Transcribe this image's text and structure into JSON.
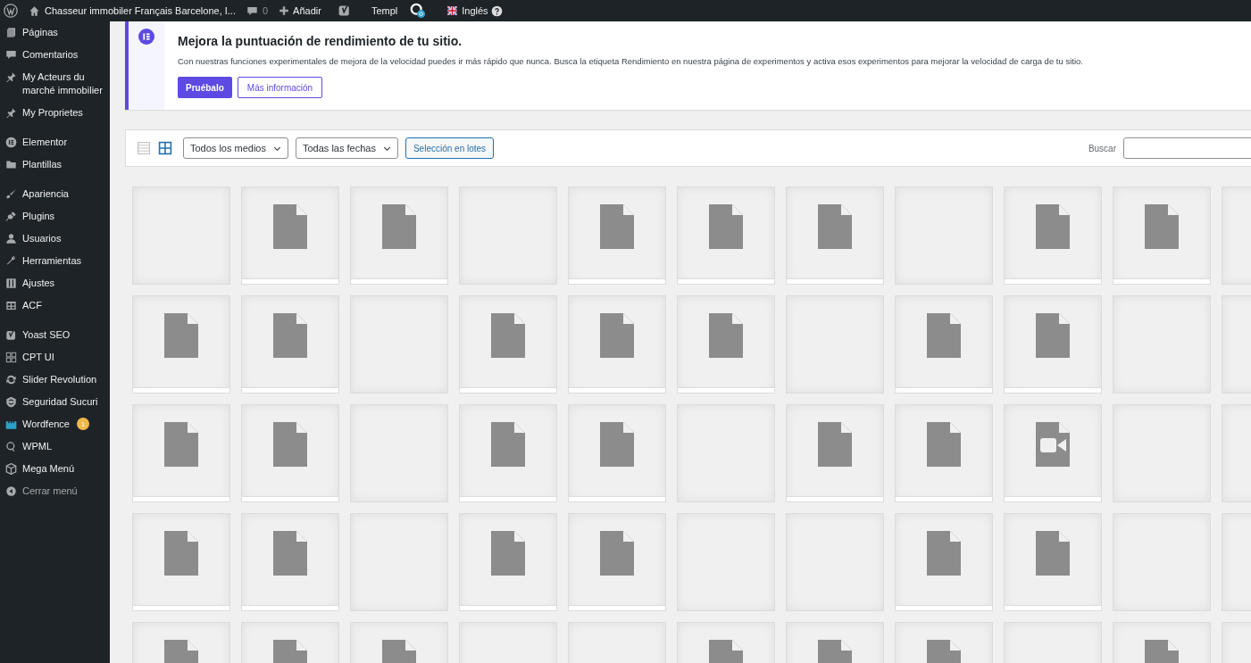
{
  "admin_bar": {
    "site_name": "Chasseur immobiler Français Barcelone, I...",
    "comments_count": "0",
    "new_label": "Añadir",
    "templ_label": "Templ",
    "language": "Inglés"
  },
  "sidebar": {
    "groups": [
      [
        {
          "label": "Páginas"
        },
        {
          "label": "Comentarios"
        },
        {
          "label": "My Acteurs du marché immobilier"
        },
        {
          "label": "My Proprietes"
        }
      ],
      [
        {
          "label": "Elementor"
        },
        {
          "label": "Plantillas"
        }
      ],
      [
        {
          "label": "Apariencia"
        },
        {
          "label": "Plugins"
        },
        {
          "label": "Usuarios"
        },
        {
          "label": "Herramientas"
        },
        {
          "label": "Ajustes"
        },
        {
          "label": "ACF"
        }
      ],
      [
        {
          "label": "Yoast SEO"
        },
        {
          "label": "CPT UI"
        },
        {
          "label": "Slider Revolution"
        },
        {
          "label": "Seguridad Sucuri"
        },
        {
          "label": "Wordfence",
          "badge": "1"
        },
        {
          "label": "WPML"
        },
        {
          "label": "Mega Menú"
        },
        {
          "label": "Cerrar menú"
        }
      ]
    ]
  },
  "notice": {
    "title": "Mejora la puntuación de rendimiento de tu sitio.",
    "body": "Con nuestras funciones experimentales de mejora de la velocidad puedes ir más rápido que nunca. Busca la etiqueta Rendimiento en nuestra página de experimentos y activa esos experimentos para mejorar la velocidad de carga de tu sitio.",
    "primary_button": "Pruébalo",
    "secondary_button": "Más información"
  },
  "toolbar": {
    "views": [
      {
        "kind": "list",
        "selected": false
      },
      {
        "kind": "grid",
        "selected": true
      }
    ],
    "type_filter": "Todos los medios",
    "date_filter": "Todas las fechas",
    "bulk_button": "Selección en lotes",
    "search_label": "Buscar"
  },
  "media_tiles": [
    {
      "kind": "empty"
    },
    {
      "kind": "document"
    },
    {
      "kind": "document"
    },
    {
      "kind": "empty"
    },
    {
      "kind": "document"
    },
    {
      "kind": "document"
    },
    {
      "kind": "document"
    },
    {
      "kind": "empty"
    },
    {
      "kind": "document"
    },
    {
      "kind": "document"
    },
    {
      "kind": "empty"
    },
    {
      "kind": "document"
    },
    {
      "kind": "document"
    },
    {
      "kind": "empty"
    },
    {
      "kind": "document"
    },
    {
      "kind": "document"
    },
    {
      "kind": "document"
    },
    {
      "kind": "empty"
    },
    {
      "kind": "document"
    },
    {
      "kind": "document"
    },
    {
      "kind": "empty"
    },
    {
      "kind": "empty"
    },
    {
      "kind": "document"
    },
    {
      "kind": "document"
    },
    {
      "kind": "empty"
    },
    {
      "kind": "document"
    },
    {
      "kind": "document"
    },
    {
      "kind": "empty"
    },
    {
      "kind": "document"
    },
    {
      "kind": "document"
    },
    {
      "kind": "video"
    },
    {
      "kind": "empty"
    },
    {
      "kind": "empty"
    },
    {
      "kind": "document"
    },
    {
      "kind": "document"
    },
    {
      "kind": "empty"
    },
    {
      "kind": "document"
    },
    {
      "kind": "document"
    },
    {
      "kind": "empty"
    },
    {
      "kind": "empty"
    },
    {
      "kind": "document"
    },
    {
      "kind": "document"
    },
    {
      "kind": "empty"
    },
    {
      "kind": "empty"
    },
    {
      "kind": "document"
    },
    {
      "kind": "document"
    },
    {
      "kind": "document"
    },
    {
      "kind": "empty"
    },
    {
      "kind": "empty"
    },
    {
      "kind": "document"
    },
    {
      "kind": "document"
    },
    {
      "kind": "document"
    },
    {
      "kind": "empty"
    },
    {
      "kind": "document"
    },
    {
      "kind": "empty"
    }
  ]
}
